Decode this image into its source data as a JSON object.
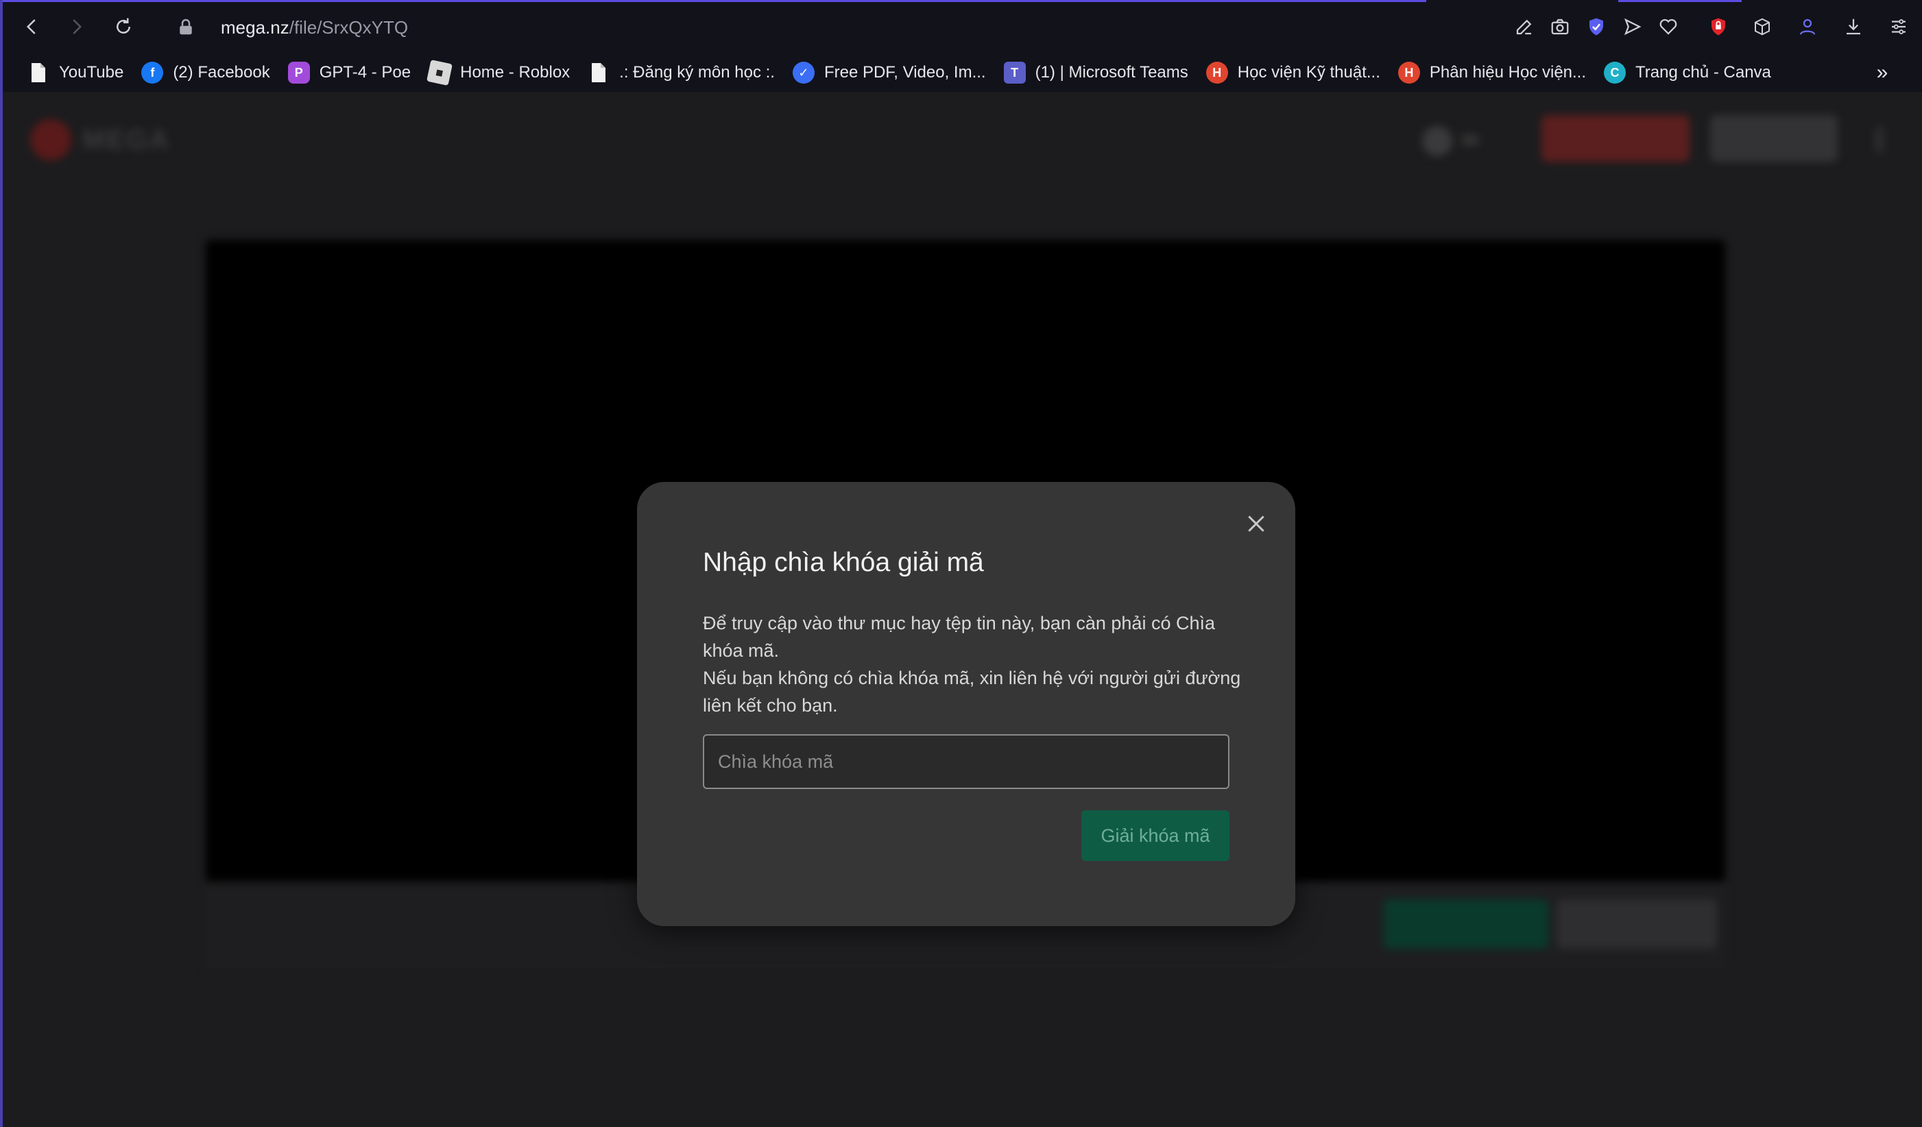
{
  "browser": {
    "url_host": "mega.nz",
    "url_path": "/file/SrxQxYTQ"
  },
  "bookmarks": [
    {
      "label": "YouTube",
      "icon": "document-icon"
    },
    {
      "label": "(2) Facebook",
      "icon": "facebook-icon",
      "color": "#1877f2",
      "glyph": "f"
    },
    {
      "label": "GPT-4 - Poe",
      "icon": "poe-icon",
      "color": "#a24bdb",
      "glyph": "P"
    },
    {
      "label": "Home - Roblox",
      "icon": "roblox-icon",
      "color": "#d8d8d8",
      "glyph": "R"
    },
    {
      "label": ".: Đăng ký môn học :.",
      "icon": "document-icon"
    },
    {
      "label": "Free PDF, Video, Im...",
      "icon": "pdf-tool-icon",
      "color": "#3b6ef5",
      "glyph": "✓"
    },
    {
      "label": "(1) | Microsoft Teams",
      "icon": "teams-icon",
      "color": "#5b5fc7",
      "glyph": "T"
    },
    {
      "label": "Học viện Kỹ thuật...",
      "icon": "academy-icon",
      "color": "#e0452f",
      "glyph": "H"
    },
    {
      "label": "Phân hiệu Học viện...",
      "icon": "academy-icon",
      "color": "#e0452f",
      "glyph": "H"
    },
    {
      "label": "Trang chủ - Canva",
      "icon": "canva-icon",
      "color": "#1fb0c8",
      "glyph": "C"
    }
  ],
  "modal": {
    "title": "Nhập chìa khóa giải mã",
    "body_line1": "Để truy cập vào thư mục hay tệp tin này, bạn càn phải có Chìa khóa mã.",
    "body_line2": "Nếu bạn không có chìa khóa mã, xin liên hệ với người gửi đường liên kết cho bạn.",
    "input_placeholder": "Chìa khóa mã",
    "input_value": "",
    "button_label": "Giải khóa mã"
  },
  "colors": {
    "accent": "#5b4de0",
    "modal_bg": "#363636",
    "button_green": "#0f5c45",
    "mega_red": "#d90007"
  }
}
